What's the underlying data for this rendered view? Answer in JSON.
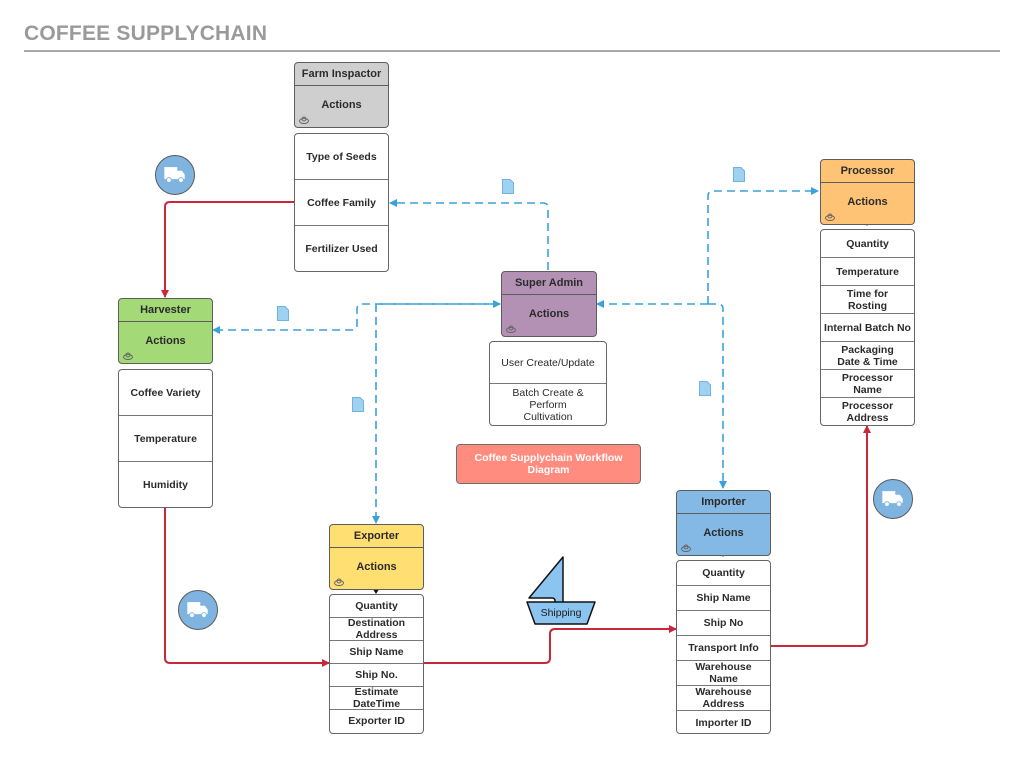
{
  "title": "COFFEE SUPPLYCHAIN",
  "legend": "Coffee Supplychain Workflow Diagram",
  "colors": {
    "farm_inspector": "#cfcfcf",
    "harvester": "#a3d977",
    "super_admin": "#b391b5",
    "processor": "#ffc375",
    "exporter": "#ffdf71",
    "importer": "#83b9e4",
    "legend": "#ff8c7f",
    "flow_line": "#c8283a",
    "data_line": "#3aa1dc",
    "truck": "#7fb4e1"
  },
  "nodes": {
    "farm_inspector": {
      "name": "Farm Inspactor",
      "action": "Actions",
      "fields": [
        "Type of Seeds",
        "Coffee Family",
        "Fertilizer Used"
      ]
    },
    "harvester": {
      "name": "Harvester",
      "action": "Actions",
      "fields": [
        "Coffee Variety",
        "Temperature",
        "Humidity"
      ]
    },
    "super_admin": {
      "name": "Super Admin",
      "action": "Actions",
      "fields": [
        "User Create/Update",
        "Batch Create & Perform Cultivation"
      ]
    },
    "processor": {
      "name": "Processor",
      "action": "Actions",
      "fields": [
        "Quantity",
        "Temperature",
        "Time for Rosting",
        "Internal Batch No",
        "Packaging Date & Time",
        "Processor Name",
        "Processor Address"
      ]
    },
    "exporter": {
      "name": "Exporter",
      "action": "Actions",
      "fields": [
        "Quantity",
        "Destination Address",
        "Ship Name",
        "Ship No.",
        "Estimate DateTime",
        "Exporter ID"
      ]
    },
    "importer": {
      "name": "Importer",
      "action": "Actions",
      "fields": [
        "Quantity",
        "Ship Name",
        "Ship No",
        "Transport Info",
        "Warehouse Name",
        "Warehouse Address",
        "Importer ID"
      ]
    }
  },
  "shipping_label": "Shipping",
  "icons": {
    "truck": "truck-icon",
    "document": "document-icon",
    "ship": "ship-icon",
    "person": "person-icon"
  }
}
